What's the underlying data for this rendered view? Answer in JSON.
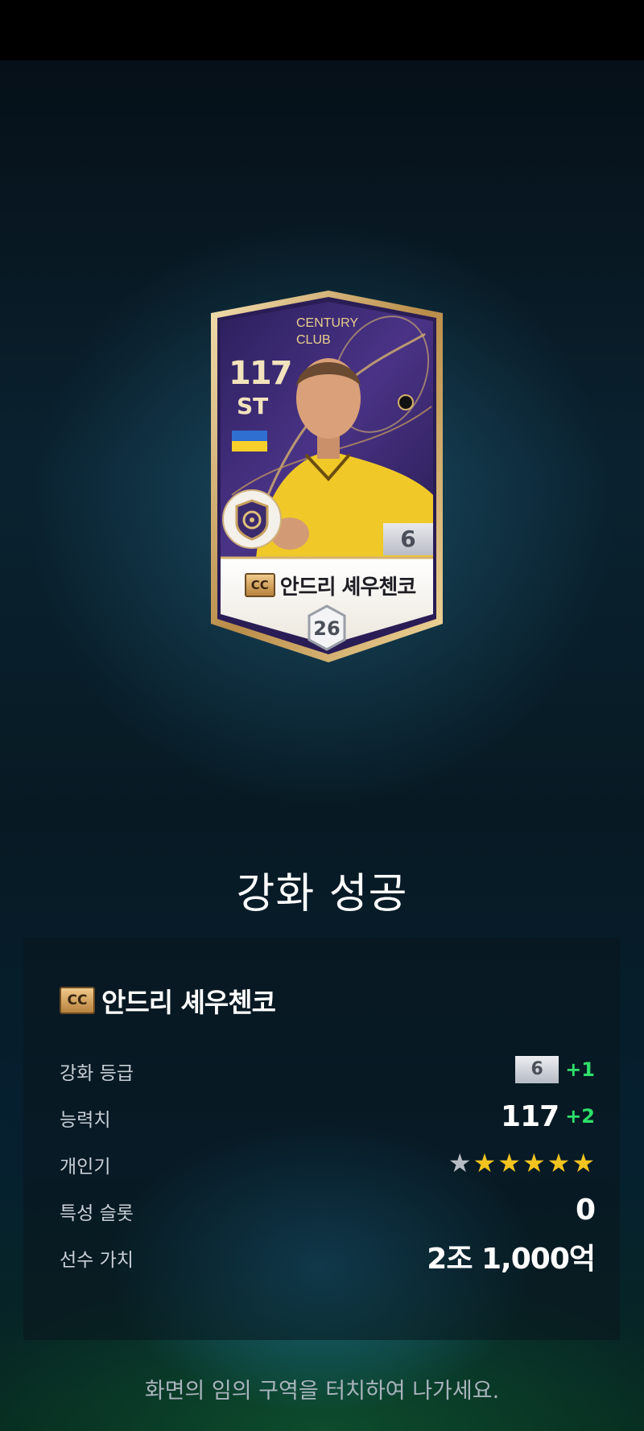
{
  "card": {
    "ovr": "117",
    "position": "ST",
    "season_line1": "CENTURY",
    "season_line2": "CLUB",
    "enhance_level": "6",
    "season_badge": "CC",
    "player_name": "안드리 셰우첸코",
    "jersey_number": "26",
    "flag": "ukraine-flag",
    "colors": {
      "frame_gold": "#d9b878",
      "card_purple": "#3b2a70",
      "shirt_yellow": "#f0c928"
    }
  },
  "result": {
    "title": "강화 성공"
  },
  "panel": {
    "season_badge": "CC",
    "player_name": "안드리 셰우첸코",
    "rows": {
      "enhance": {
        "label": "강화 등급",
        "level": "6",
        "delta": "+1"
      },
      "ovr": {
        "label": "능력치",
        "value": "117",
        "delta": "+2"
      },
      "skill": {
        "label": "개인기",
        "stars_filled": 5,
        "stars_total": 6
      },
      "trait": {
        "label": "특성 슬롯",
        "value": "0"
      },
      "price": {
        "label": "선수 가치",
        "value": "2조 1,000억"
      }
    }
  },
  "footer": {
    "hint": "화면의 임의 구역을 터치하여 나가세요."
  }
}
